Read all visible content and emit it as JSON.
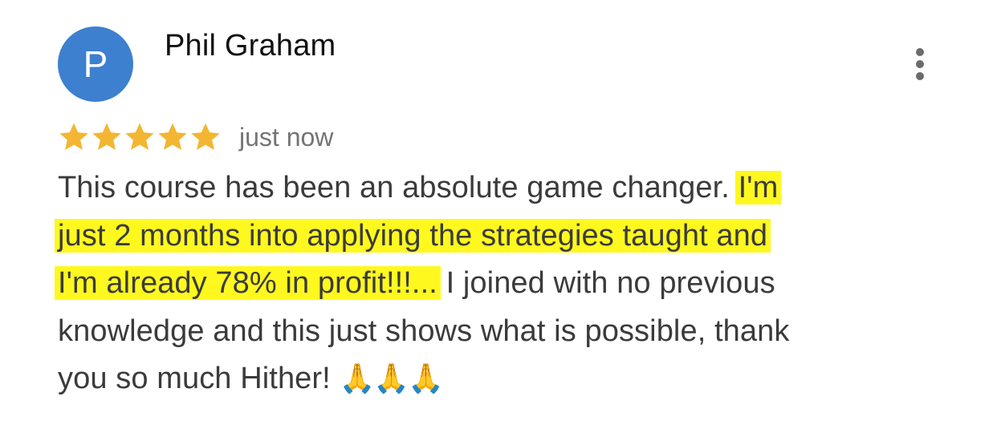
{
  "reviewer": {
    "initial": "P",
    "name": "Phil Graham"
  },
  "rating": {
    "value": 5,
    "max": 5,
    "star_color": "#f2b632",
    "timestamp": "just now"
  },
  "review": {
    "line1_plain": "This course has been an absolute game changer.",
    "line1_highlight": "I'm",
    "line2_highlight": "just 2 months into applying the strategies taught and",
    "line3_highlight": "I'm already 78% in profit!!!...",
    "line3_plain": "I joined with no previous",
    "line4_plain": "knowledge and this just shows what is possible, thank",
    "line5_plain": "you so much Hither!",
    "emoji": "🙏🙏🙏",
    "highlight_color": "#fff81f"
  },
  "menu": {
    "icon": "more-vert-icon"
  },
  "colors": {
    "avatar_bg": "#3c80cf",
    "text": "#3b3b3b",
    "muted": "#747474"
  }
}
